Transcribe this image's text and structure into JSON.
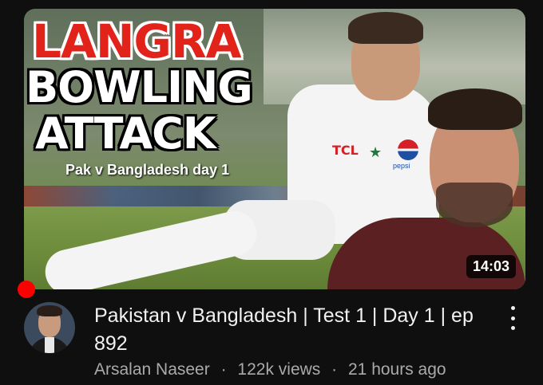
{
  "thumbnail": {
    "title_line1": "LANGRA",
    "title_line2": "BOWLING",
    "title_line3": "ATTACK",
    "subtitle": "Pak v Bangladesh day 1",
    "jersey_sponsor": "TCL",
    "pepsi_text": "pepsi",
    "duration": "14:03"
  },
  "video": {
    "title": "Pakistan v Bangladesh | Test 1 | Day 1 | ep 892",
    "channel": "Arsalan Naseer",
    "views": "122k views",
    "age": "21 hours ago",
    "separator": "·"
  },
  "colors": {
    "background": "#0f0f0f",
    "title_red": "#e2231a",
    "progress_red": "#ff0000",
    "meta_text": "#aaaaaa"
  },
  "icons": {
    "more": "three-dot-vertical"
  }
}
